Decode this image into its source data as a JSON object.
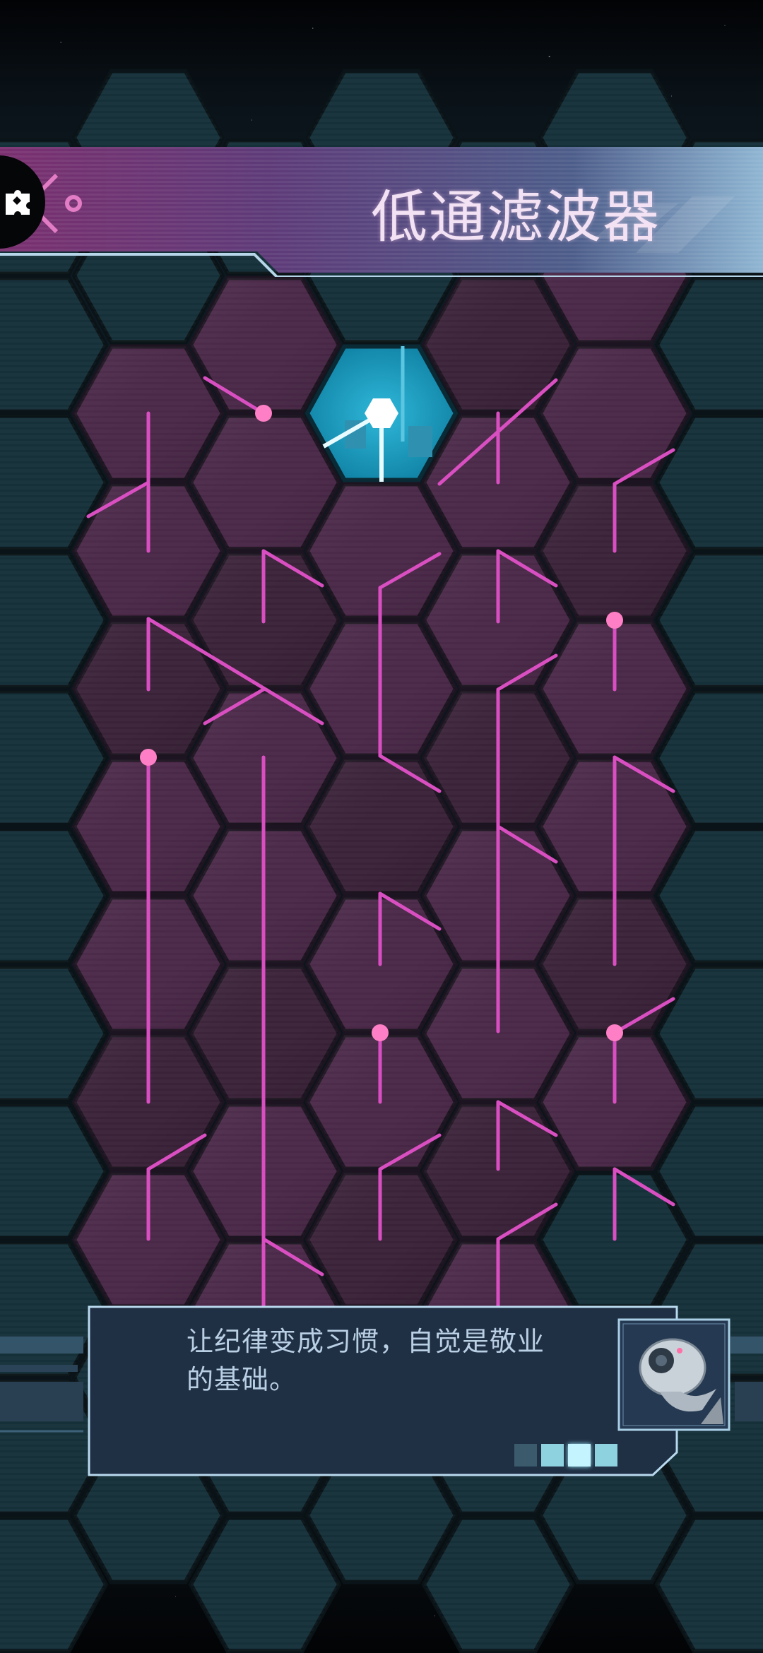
{
  "level": {
    "title": "低通滤波器"
  },
  "menu": {
    "icon": "puzzle-piece-icon"
  },
  "tip": {
    "line1": "让纪律变成习惯，自觉是敬业",
    "line2": "的基础。",
    "pages_total": 4,
    "current_page": 3,
    "avatar_icon": "robot-head-icon"
  },
  "colors": {
    "tile_fill": "#4a2848",
    "tile_fill_dark": "#3a2238",
    "background_tile": "#16303a",
    "wire": "#d94fc2",
    "node": "#ff7fc6",
    "source_tile": "#1aa4c7",
    "source_glow": "#e8fbff",
    "banner_accent": "#ba4fa2"
  }
}
